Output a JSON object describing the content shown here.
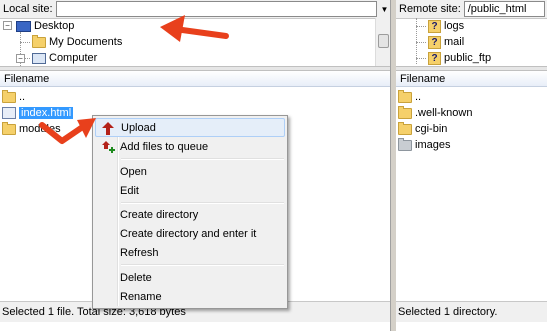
{
  "local": {
    "site_label": "Local site:",
    "site_value": "",
    "tree": [
      "Desktop",
      "My Documents",
      "Computer"
    ],
    "header": "Filename",
    "files": [
      "..",
      "index.html",
      "modules"
    ],
    "status": "Selected 1 file. Total size: 3,618 bytes"
  },
  "remote": {
    "site_label": "Remote site:",
    "site_value": "/public_html",
    "tree": [
      "logs",
      "mail",
      "public_ftp"
    ],
    "header": "Filename",
    "files": [
      "..",
      ".well-known",
      "cgi-bin",
      "images"
    ],
    "status": "Selected 1 directory."
  },
  "context_menu": {
    "upload": "Upload",
    "add_to_queue": "Add files to queue",
    "open": "Open",
    "edit": "Edit",
    "create_directory": "Create directory",
    "create_directory_enter": "Create directory and enter it",
    "refresh": "Refresh",
    "delete": "Delete",
    "rename": "Rename"
  },
  "colors": {
    "selection": "#3399ff",
    "arrow": "#e8401c"
  },
  "icons": {
    "folder": "folder-icon",
    "file": "html-file-icon",
    "upload": "upload-arrow-icon",
    "add_queue": "add-to-queue-icon"
  }
}
